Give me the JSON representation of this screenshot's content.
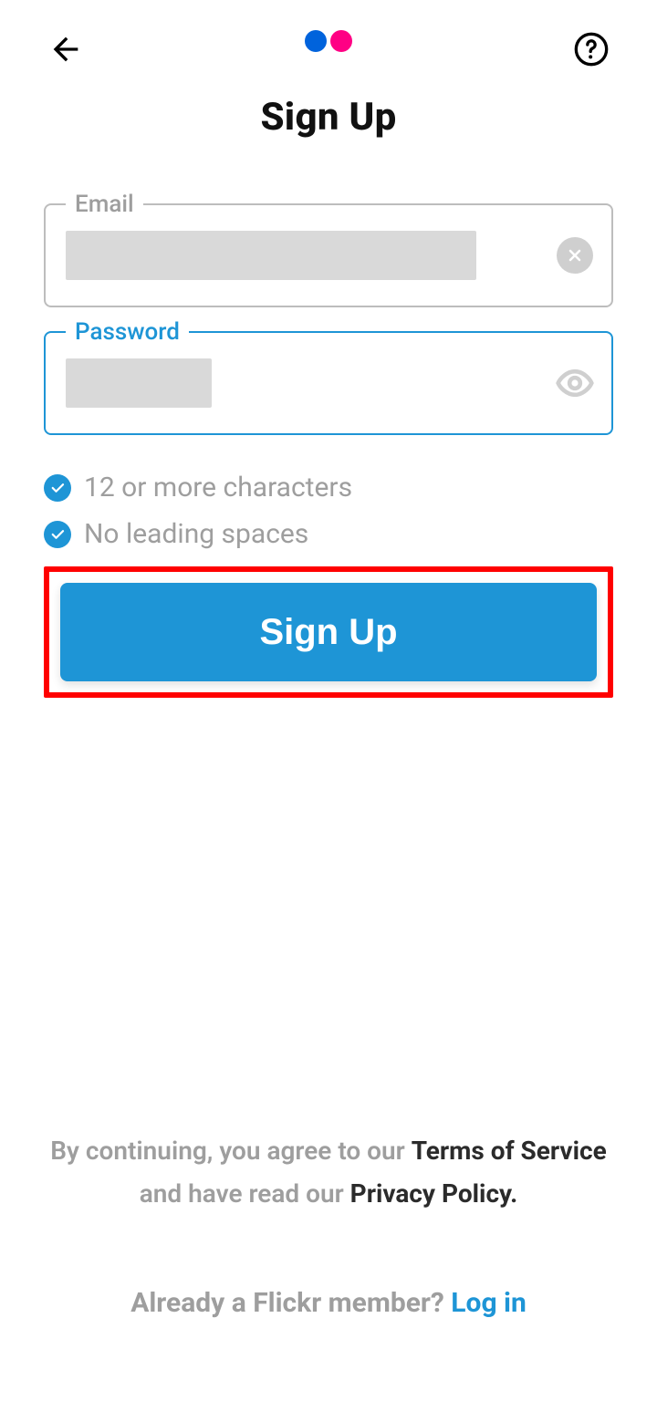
{
  "colors": {
    "accent": "#1e95d6",
    "logo_blue": "#0063dc",
    "logo_pink": "#ff0084",
    "highlight": "#ff0000"
  },
  "header": {
    "title": "Sign Up"
  },
  "form": {
    "email": {
      "label": "Email",
      "value": "",
      "has_clear": true
    },
    "password": {
      "label": "Password",
      "value": "",
      "active": true
    }
  },
  "requirements": [
    {
      "met": true,
      "text": "12 or more characters"
    },
    {
      "met": true,
      "text": "No leading spaces"
    }
  ],
  "actions": {
    "signup_label": "Sign Up"
  },
  "footer": {
    "terms_prefix": "By continuing, you agree to our ",
    "terms_link": "Terms of Service",
    "terms_mid": " and have read our ",
    "privacy_link": "Privacy Policy.",
    "login_prompt": "Already a Flickr member? ",
    "login_link": "Log in"
  }
}
